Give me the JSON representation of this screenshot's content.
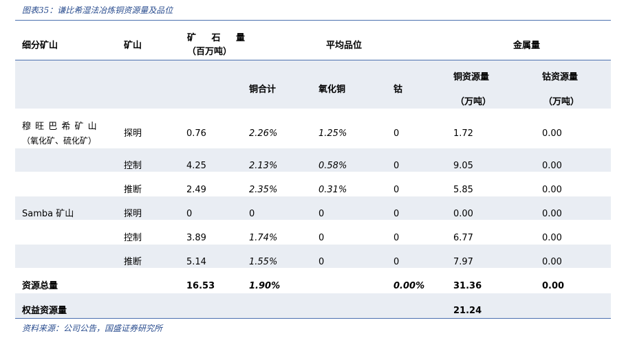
{
  "caption": "图表35：谦比希湿法冶炼铜资源量及品位",
  "source": "资料来源：公司公告，国盛证券研究所",
  "headers": {
    "col_mine": "细分矿山",
    "col_ore_type": "矿山",
    "col_ore_line1": "矿 石 量",
    "col_ore_line2": "（百万吨）",
    "col_grade_group": "平均品位",
    "col_metal_group": "金属量",
    "col_cu_total": "铜合计",
    "col_cu_oxide": "氧化铜",
    "col_cobalt": "钴",
    "col_cu_res_line1": "铜资源量",
    "col_cu_res_line2": "（万吨）",
    "col_co_res_line1": "钴资源量",
    "col_co_res_line2": "（万吨）"
  },
  "rows": [
    {
      "mine_line1": "穆 旺 巴 希 矿 山",
      "mine_line2": "（氧化矿、硫化矿）",
      "cat": "探明",
      "ore": "0.76",
      "cu_total": "2.26%",
      "cu_oxide": "1.25%",
      "cobalt": "0",
      "cu_res": "1.72",
      "co_res": "0.00"
    },
    {
      "mine_line1": "",
      "mine_line2": "",
      "cat": "控制",
      "ore": "4.25",
      "cu_total": "2.13%",
      "cu_oxide": "0.58%",
      "cobalt": "0",
      "cu_res": "9.05",
      "co_res": "0.00"
    },
    {
      "mine_line1": "",
      "mine_line2": "",
      "cat": "推断",
      "ore": "2.49",
      "cu_total": "2.35%",
      "cu_oxide": "0.31%",
      "cobalt": "0",
      "cu_res": "5.85",
      "co_res": "0.00"
    },
    {
      "mine_line1": "Samba 矿山",
      "mine_line2": "",
      "cat": "探明",
      "ore": "0",
      "cu_total": "0",
      "cu_oxide": "0",
      "cobalt": "0",
      "cu_res": "0.00",
      "co_res": "0.00"
    },
    {
      "mine_line1": "",
      "mine_line2": "",
      "cat": "控制",
      "ore": "3.89",
      "cu_total": "1.74%",
      "cu_oxide": "0",
      "cobalt": "0",
      "cu_res": "6.77",
      "co_res": "0.00"
    },
    {
      "mine_line1": "",
      "mine_line2": "",
      "cat": "推断",
      "ore": "5.14",
      "cu_total": "1.55%",
      "cu_oxide": "0",
      "cobalt": "0",
      "cu_res": "7.97",
      "co_res": "0.00"
    }
  ],
  "total_row": {
    "label": "资源总量",
    "ore": "16.53",
    "cu_total": "1.90%",
    "cobalt": "0.00%",
    "cu_res": "31.36",
    "co_res": "0.00"
  },
  "equity_row": {
    "label": "权益资源量",
    "cu_res": "21.24"
  }
}
